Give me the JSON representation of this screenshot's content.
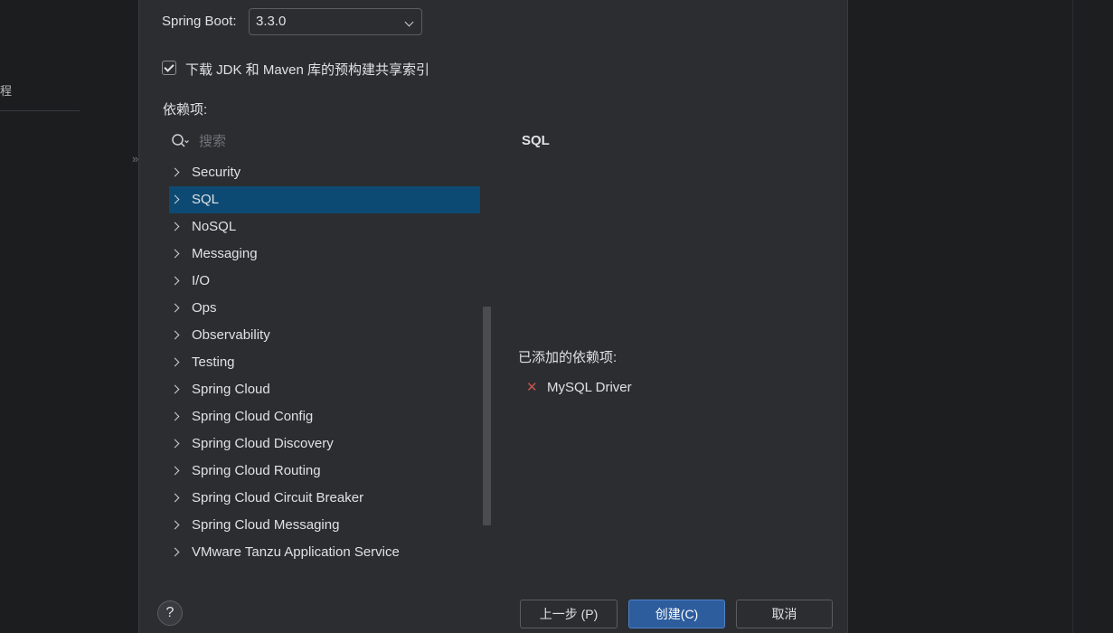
{
  "background": {
    "left_label": "程",
    "chevron": "»"
  },
  "spring_boot": {
    "label": "Spring Boot:",
    "version": "3.3.0"
  },
  "download_checkbox": {
    "checked": true,
    "label": "下载 JDK 和 Maven 库的预构建共享索引"
  },
  "dependencies": {
    "label": "依赖项:",
    "search_placeholder": "搜索",
    "categories": [
      {
        "label": "Security",
        "selected": false
      },
      {
        "label": "SQL",
        "selected": true
      },
      {
        "label": "NoSQL",
        "selected": false
      },
      {
        "label": "Messaging",
        "selected": false
      },
      {
        "label": "I/O",
        "selected": false
      },
      {
        "label": "Ops",
        "selected": false
      },
      {
        "label": "Observability",
        "selected": false
      },
      {
        "label": "Testing",
        "selected": false
      },
      {
        "label": "Spring Cloud",
        "selected": false
      },
      {
        "label": "Spring Cloud Config",
        "selected": false
      },
      {
        "label": "Spring Cloud Discovery",
        "selected": false
      },
      {
        "label": "Spring Cloud Routing",
        "selected": false
      },
      {
        "label": "Spring Cloud Circuit Breaker",
        "selected": false
      },
      {
        "label": "Spring Cloud Messaging",
        "selected": false
      },
      {
        "label": "VMware Tanzu Application Service",
        "selected": false
      }
    ]
  },
  "detail": {
    "title": "SQL"
  },
  "added": {
    "label": "已添加的依赖项:",
    "items": [
      "MySQL Driver"
    ]
  },
  "footer": {
    "help": "?",
    "back": "上一步 (P)",
    "create": "创建(C)",
    "cancel": "取消"
  },
  "colors": {
    "selection": "#0d4a73",
    "remove_icon": "#c75450",
    "primary_button": "#2e5d9e"
  }
}
